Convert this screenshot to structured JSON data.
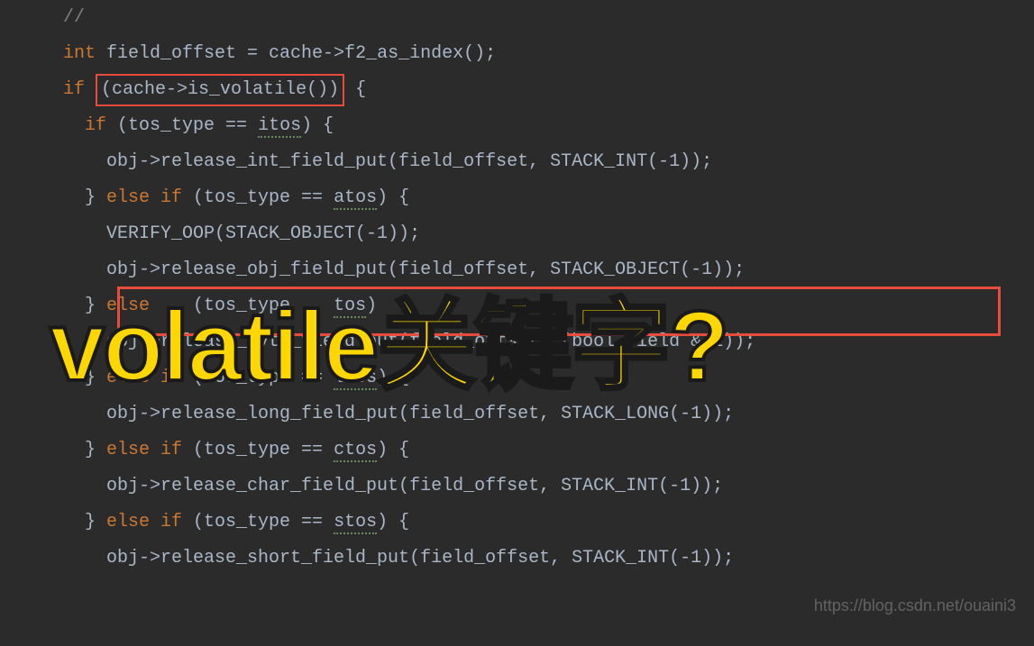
{
  "code": {
    "l1_comment": "//",
    "l2a": "int",
    "l2b": " field_offset = cache->f2_as_index();",
    "l3a": "if",
    "l3b": " ",
    "l3box": "(cache->is_volatile())",
    "l3c": " {",
    "l4a": "if",
    "l4b": " (tos_type == ",
    "l4u": "itos",
    "l4c": ") {",
    "l5": "    obj->release_int_field_put(field_offset, STACK_INT(-1));",
    "l6a": "  } ",
    "l6b": "else if",
    "l6c": " (tos_type == ",
    "l6u": "atos",
    "l6d": ") {",
    "l7": "    VERIFY_OOP(STACK_OBJECT(-1));",
    "l8": "    obj->release_obj_field_put(field_offset, STACK_OBJECT(-1));",
    "l9a": "  } ",
    "l9b": "else",
    "l9c": "    (tos_type    ",
    "l9u": "tos",
    "l9d": ")  {",
    "l10": "",
    "l11": "",
    "l12": "    obj->release_byte_field_put(field_offset, (bool_field & 1));",
    "l13a": "  } ",
    "l13b": "else if",
    "l13c": " (tos_type == ",
    "l13u": "ltos",
    "l13d": ") {",
    "l14": "    obj->release_long_field_put(field_offset, STACK_LONG(-1));",
    "l15a": "  } ",
    "l15b": "else if",
    "l15c": " (tos_type == ",
    "l15u": "ctos",
    "l15d": ") {",
    "l16": "    obj->release_char_field_put(field_offset, STACK_INT(-1));",
    "l17a": "  } ",
    "l17b": "else if",
    "l17c": " (tos_type == ",
    "l17u": "stos",
    "l17d": ") {",
    "l18": "    obj->release_short_field_put(field_offset, STACK_INT(-1));"
  },
  "overlay_text": "volatile关键字?",
  "watermark": "https://blog.csdn.net/ouaini3"
}
